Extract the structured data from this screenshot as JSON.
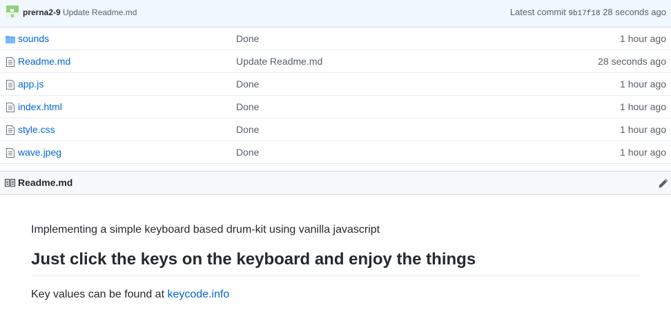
{
  "commit": {
    "author": "prerna2-9",
    "message": "Update Readme.md",
    "latest_label": "Latest commit",
    "sha": "9b17f18",
    "age": "28 seconds ago"
  },
  "files": [
    {
      "name": "sounds",
      "icon": "folder-icon",
      "message": "Done",
      "age": "1 hour ago"
    },
    {
      "name": "Readme.md",
      "icon": "file-icon",
      "message": "Update Readme.md",
      "age": "28 seconds ago"
    },
    {
      "name": "app.js",
      "icon": "file-icon",
      "message": "Done",
      "age": "1 hour ago"
    },
    {
      "name": "index.html",
      "icon": "file-icon",
      "message": "Done",
      "age": "1 hour ago"
    },
    {
      "name": "style.css",
      "icon": "file-icon",
      "message": "Done",
      "age": "1 hour ago"
    },
    {
      "name": "wave.jpeg",
      "icon": "file-icon",
      "message": "Done",
      "age": "1 hour ago"
    }
  ],
  "readme": {
    "title": "Readme.md",
    "intro": "Implementing a simple keyboard based drum-kit using vanilla javascript",
    "heading": "Just click the keys on the keyboard and enjoy the things",
    "keys_text": "Key values can be found at ",
    "keys_link": "keycode.info"
  },
  "colors": {
    "link": "#0366d6",
    "muted": "#586069",
    "commit_bar_bg": "#f1f8ff",
    "folder_icon": "#79b8ff"
  }
}
